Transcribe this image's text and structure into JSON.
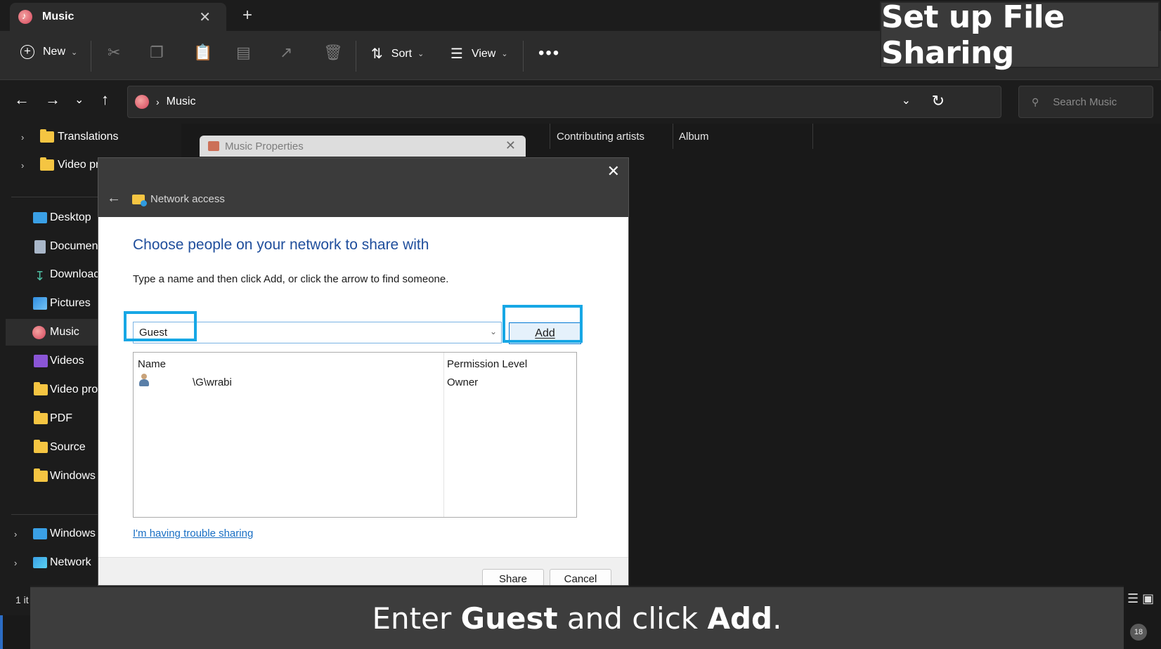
{
  "window": {
    "tab_title": "Music",
    "tab_close": "✕",
    "new_tab": "+"
  },
  "toolbar": {
    "new_label": "New",
    "sort_label": "Sort",
    "view_label": "View",
    "more_label": "•••"
  },
  "address": {
    "path": "Music",
    "search_placeholder": "Search Music"
  },
  "sidebar": {
    "items": [
      {
        "label": "Translations"
      },
      {
        "label": "Video pr"
      },
      {
        "label": "Desktop"
      },
      {
        "label": "Documen"
      },
      {
        "label": "Downloac"
      },
      {
        "label": "Pictures"
      },
      {
        "label": "Music"
      },
      {
        "label": "Videos"
      },
      {
        "label": "Video pro"
      },
      {
        "label": "PDF"
      },
      {
        "label": "Source"
      },
      {
        "label": "Windows"
      },
      {
        "label": "Windows"
      },
      {
        "label": "Network"
      }
    ]
  },
  "columns": {
    "contributing": "Contributing artists",
    "album": "Album"
  },
  "properties_window": {
    "title": "Music Properties"
  },
  "dialog": {
    "breadcrumb": "Network access",
    "heading": "Choose people on your network to share with",
    "instruction": "Type a name and then click Add, or click the arrow to find someone.",
    "input_value": "Guest",
    "add_button": "Add",
    "grid": {
      "col_name": "Name",
      "col_permission": "Permission Level",
      "rows": [
        {
          "name": "\\G\\wrabi",
          "permission": "Owner"
        }
      ]
    },
    "trouble_link": "I'm having trouble sharing",
    "share_button": "Share",
    "cancel_button": "Cancel"
  },
  "status": {
    "items": "1 it",
    "badge": "18"
  },
  "overlay": {
    "title": "Set up File Sharing",
    "caption_pre": "Enter ",
    "caption_bold1": "Guest",
    "caption_mid": " and click ",
    "caption_bold2": "Add",
    "caption_post": "."
  },
  "colors": {
    "highlight": "#17a7e5",
    "heading_blue": "#1f4e9c",
    "link_blue": "#1a6fc4"
  }
}
